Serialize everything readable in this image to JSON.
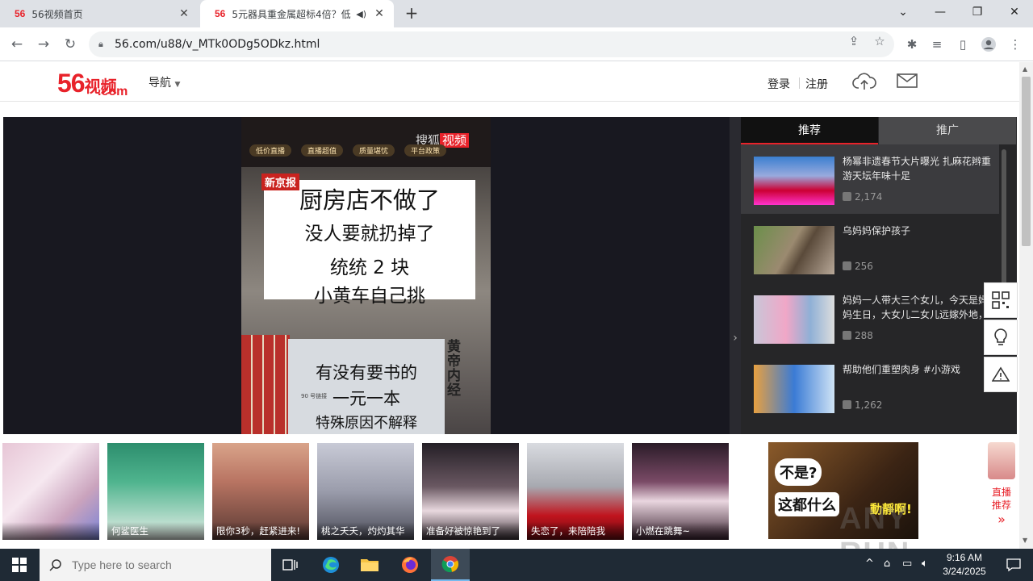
{
  "browser": {
    "tabs": [
      {
        "favicon": "56",
        "title": "56视频首页"
      },
      {
        "favicon": "56",
        "title": "5元器具重金属超标4倍？低"
      }
    ],
    "url": "56.com/u88/v_MTk0ODg5ODkz.html"
  },
  "site": {
    "logo_num": "56",
    "logo_cn": "视频",
    "logo_domain": ".com",
    "nav_label": "导航",
    "login": "登录",
    "register": "注册"
  },
  "video": {
    "tags": [
      "低价直播",
      "直播超值",
      "质量堪忧",
      "平台政策"
    ],
    "sohu": "搜狐",
    "sohu_red": "视频",
    "source": "新京报",
    "card_lines": [
      "厨房店不做了",
      "没人要就扔掉了",
      "统统 2 块",
      "小黄车自己挑"
    ],
    "sign_lines": [
      "有没有要书的",
      "一元一本",
      "特殊原因不解释"
    ],
    "sign_tiny": "90 号链接",
    "emperor_book": "黄帝内经"
  },
  "recommend": {
    "tabs": [
      "推荐",
      "推广"
    ],
    "items": [
      {
        "title": "杨幂非遗春节大片曝光 扎麻花辫重游天坛年味十足",
        "plays": "2,174"
      },
      {
        "title": "乌妈妈保护孩子",
        "plays": "256"
      },
      {
        "title": "妈妈一人带大三个女儿，今天是妈妈生日，大女儿二女儿远嫁外地，",
        "plays": "288"
      },
      {
        "title": "帮助他们重塑肉身 #小游戏",
        "plays": "1,262"
      }
    ]
  },
  "strip": {
    "items": [
      {
        "caption": ""
      },
      {
        "caption": "何鲨医生"
      },
      {
        "caption": "限你3秒，赶紧进来!"
      },
      {
        "caption": "桃之夭夭，灼灼其华"
      },
      {
        "caption": "准备好被惊艳到了"
      },
      {
        "caption": "失恋了，来陪陪我"
      },
      {
        "caption": "小燃在跳舞~"
      }
    ],
    "ad_lines": [
      "不是?",
      "这都什么",
      "動靜啊!"
    ],
    "live_label": "直播推荐"
  },
  "watermark": "ANY RUN",
  "taskbar": {
    "search_placeholder": "Type here to search",
    "time": "9:16 AM",
    "date": "3/24/2025"
  },
  "colors": {
    "brand_red": "#e8222a",
    "player_bg": "#181820",
    "panel_bg": "#262628",
    "taskbar_bg": "#1f2a35"
  }
}
